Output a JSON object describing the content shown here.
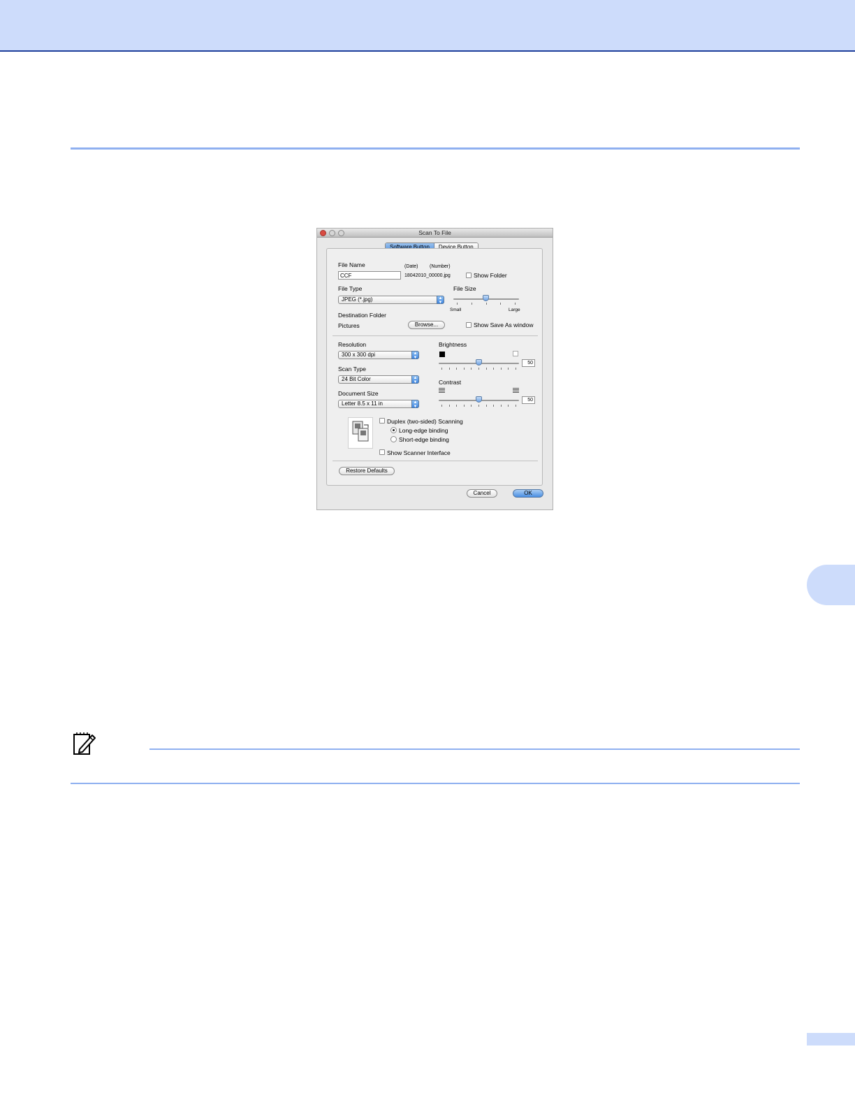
{
  "dialog": {
    "title": "Scan To File",
    "tabs": [
      {
        "label": "Software Button",
        "active": true
      },
      {
        "label": "Device Button",
        "active": false
      }
    ],
    "file_name": {
      "label": "File Name",
      "value": "CCF",
      "date_label": "(Date)",
      "number_label": "(Number)",
      "preview": "18042010_00000.jpg",
      "show_folder_label": "Show Folder",
      "show_folder_checked": false
    },
    "file_type": {
      "label": "File Type",
      "selected": "JPEG (*.jpg)"
    },
    "file_size": {
      "label": "File Size",
      "min_label": "Small",
      "max_label": "Large",
      "level": 0.5
    },
    "destination": {
      "label": "Destination Folder",
      "value": "Pictures",
      "browse_label": "Browse...",
      "show_save_as_label": "Show Save As window",
      "show_save_as_checked": false
    },
    "resolution": {
      "label": "Resolution",
      "selected": "300 x 300 dpi"
    },
    "scan_type": {
      "label": "Scan Type",
      "selected": "24 Bit Color"
    },
    "document_size": {
      "label": "Document Size",
      "selected": "Letter  8.5 x 11 in"
    },
    "brightness": {
      "label": "Brightness",
      "value": "50",
      "level": 0.5
    },
    "contrast": {
      "label": "Contrast",
      "value": "50",
      "level": 0.5
    },
    "duplex": {
      "label": "Duplex (two-sided) Scanning",
      "checked": false,
      "long_edge_label": "Long-edge binding",
      "short_edge_label": "Short-edge binding",
      "binding_selected": "long"
    },
    "show_scanner_interface": {
      "label": "Show Scanner Interface",
      "checked": false
    },
    "restore_defaults_label": "Restore Defaults",
    "cancel_label": "Cancel",
    "ok_label": "OK"
  },
  "icons": {
    "note": "note-pencil-icon"
  },
  "colors": {
    "band": "#cddcfb",
    "band_border": "#1f3f9a",
    "rule": "#8fb0f0",
    "aqua_blue": "#5b97e0"
  }
}
